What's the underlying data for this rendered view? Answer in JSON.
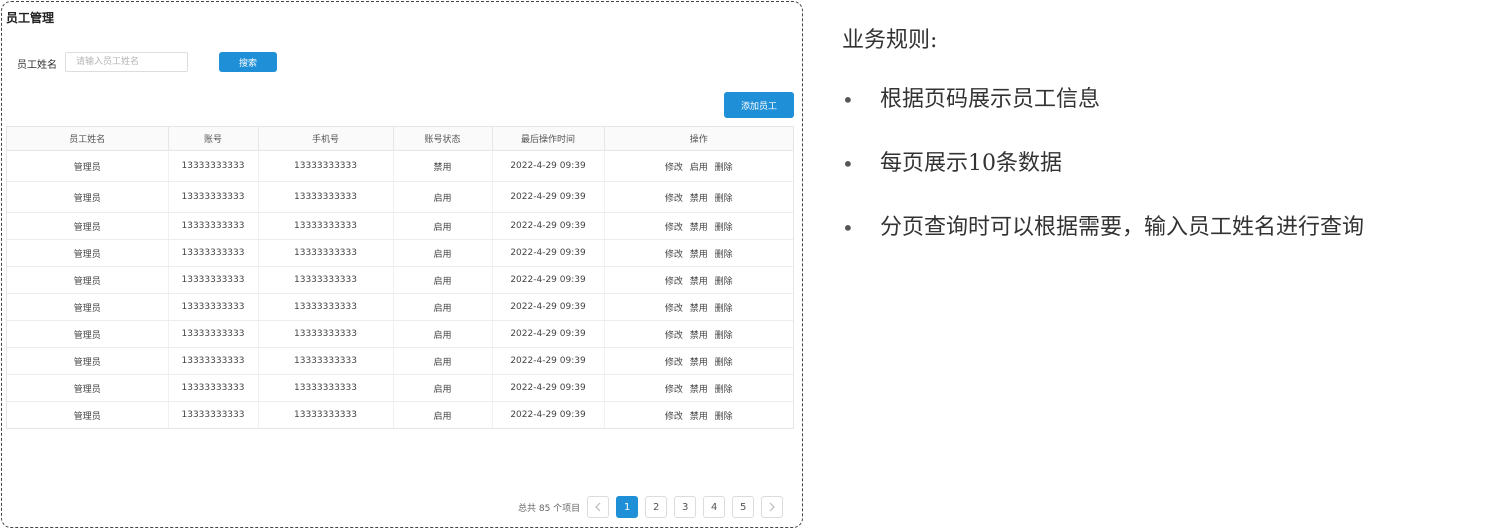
{
  "panel": {
    "title": "员工管理",
    "search": {
      "label": "员工姓名",
      "placeholder": "请输入员工姓名",
      "button_label": "搜索"
    },
    "add_button_label": "添加员工",
    "table": {
      "columns": [
        "员工姓名",
        "账号",
        "手机号",
        "账号状态",
        "最后操作时间",
        "操作"
      ],
      "rows": [
        {
          "name": "管理员",
          "account": "13333333333",
          "phone": "13333333333",
          "status": "禁用",
          "time": "2022-4-29 09:39",
          "ops": [
            "修改",
            "启用",
            "删除"
          ]
        },
        {
          "name": "管理员",
          "account": "13333333333",
          "phone": "13333333333",
          "status": "启用",
          "time": "2022-4-29 09:39",
          "ops": [
            "修改",
            "禁用",
            "删除"
          ]
        },
        {
          "name": "管理员",
          "account": "13333333333",
          "phone": "13333333333",
          "status": "启用",
          "time": "2022-4-29 09:39",
          "ops": [
            "修改",
            "禁用",
            "删除"
          ]
        },
        {
          "name": "管理员",
          "account": "13333333333",
          "phone": "13333333333",
          "status": "启用",
          "time": "2022-4-29 09:39",
          "ops": [
            "修改",
            "禁用",
            "删除"
          ]
        },
        {
          "name": "管理员",
          "account": "13333333333",
          "phone": "13333333333",
          "status": "启用",
          "time": "2022-4-29 09:39",
          "ops": [
            "修改",
            "禁用",
            "删除"
          ]
        },
        {
          "name": "管理员",
          "account": "13333333333",
          "phone": "13333333333",
          "status": "启用",
          "time": "2022-4-29 09:39",
          "ops": [
            "修改",
            "禁用",
            "删除"
          ]
        },
        {
          "name": "管理员",
          "account": "13333333333",
          "phone": "13333333333",
          "status": "启用",
          "time": "2022-4-29 09:39",
          "ops": [
            "修改",
            "禁用",
            "删除"
          ]
        },
        {
          "name": "管理员",
          "account": "13333333333",
          "phone": "13333333333",
          "status": "启用",
          "time": "2022-4-29 09:39",
          "ops": [
            "修改",
            "禁用",
            "删除"
          ]
        },
        {
          "name": "管理员",
          "account": "13333333333",
          "phone": "13333333333",
          "status": "启用",
          "time": "2022-4-29 09:39",
          "ops": [
            "修改",
            "禁用",
            "删除"
          ]
        },
        {
          "name": "管理员",
          "account": "13333333333",
          "phone": "13333333333",
          "status": "启用",
          "time": "2022-4-29 09:39",
          "ops": [
            "修改",
            "禁用",
            "删除"
          ]
        }
      ]
    },
    "pagination": {
      "total_text": "总共 85 个项目",
      "prev_icon": "chevron-left-icon",
      "next_icon": "chevron-right-icon",
      "pages": [
        "1",
        "2",
        "3",
        "4",
        "5"
      ],
      "current": "1"
    }
  },
  "rules": {
    "title": "业务规则:",
    "items": [
      "根据页码展示员工信息",
      "每页展示10条数据",
      "分页查询时可以根据需要，输入员工姓名进行查询"
    ]
  },
  "colors": {
    "primary": "#1f8fd8"
  }
}
